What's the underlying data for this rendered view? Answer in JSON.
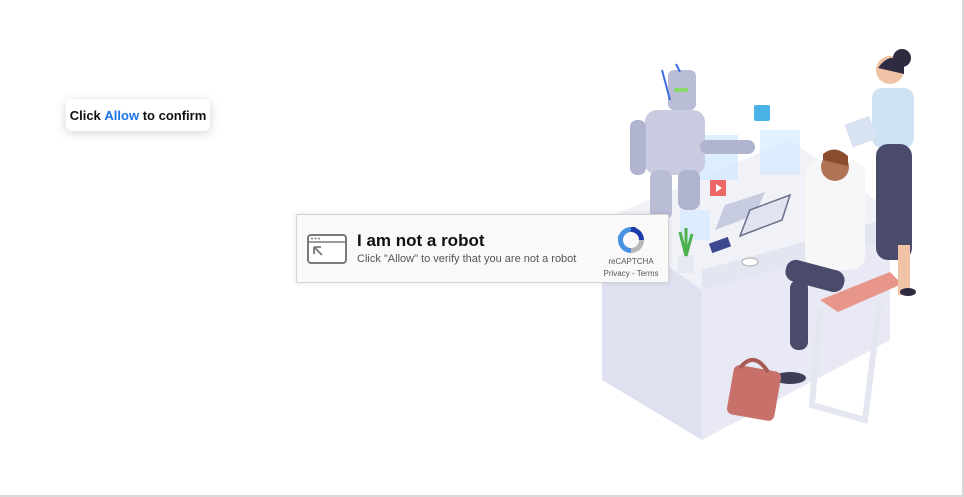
{
  "tooltip": {
    "prefix": "Click",
    "highlight": "Allow",
    "suffix": "to confirm"
  },
  "captcha": {
    "title": "I am not a robot",
    "subtitle": "Click \"Allow\" to verify that you are not a robot",
    "brand": "reCAPTCHA",
    "privacy_link": "Privacy",
    "separator": "-",
    "terms_link": "Terms"
  },
  "colors": {
    "accent": "#1a73e8",
    "captcha_bg": "#f9f9f9",
    "captcha_border": "#d3d3d3",
    "recaptcha_blue": "#1c3aa9",
    "recaptcha_light": "#4a90e2",
    "recaptcha_gray": "#b7b7b7"
  },
  "icons": {
    "window": "browser-window-icon",
    "recaptcha": "recaptcha-logo-icon"
  }
}
